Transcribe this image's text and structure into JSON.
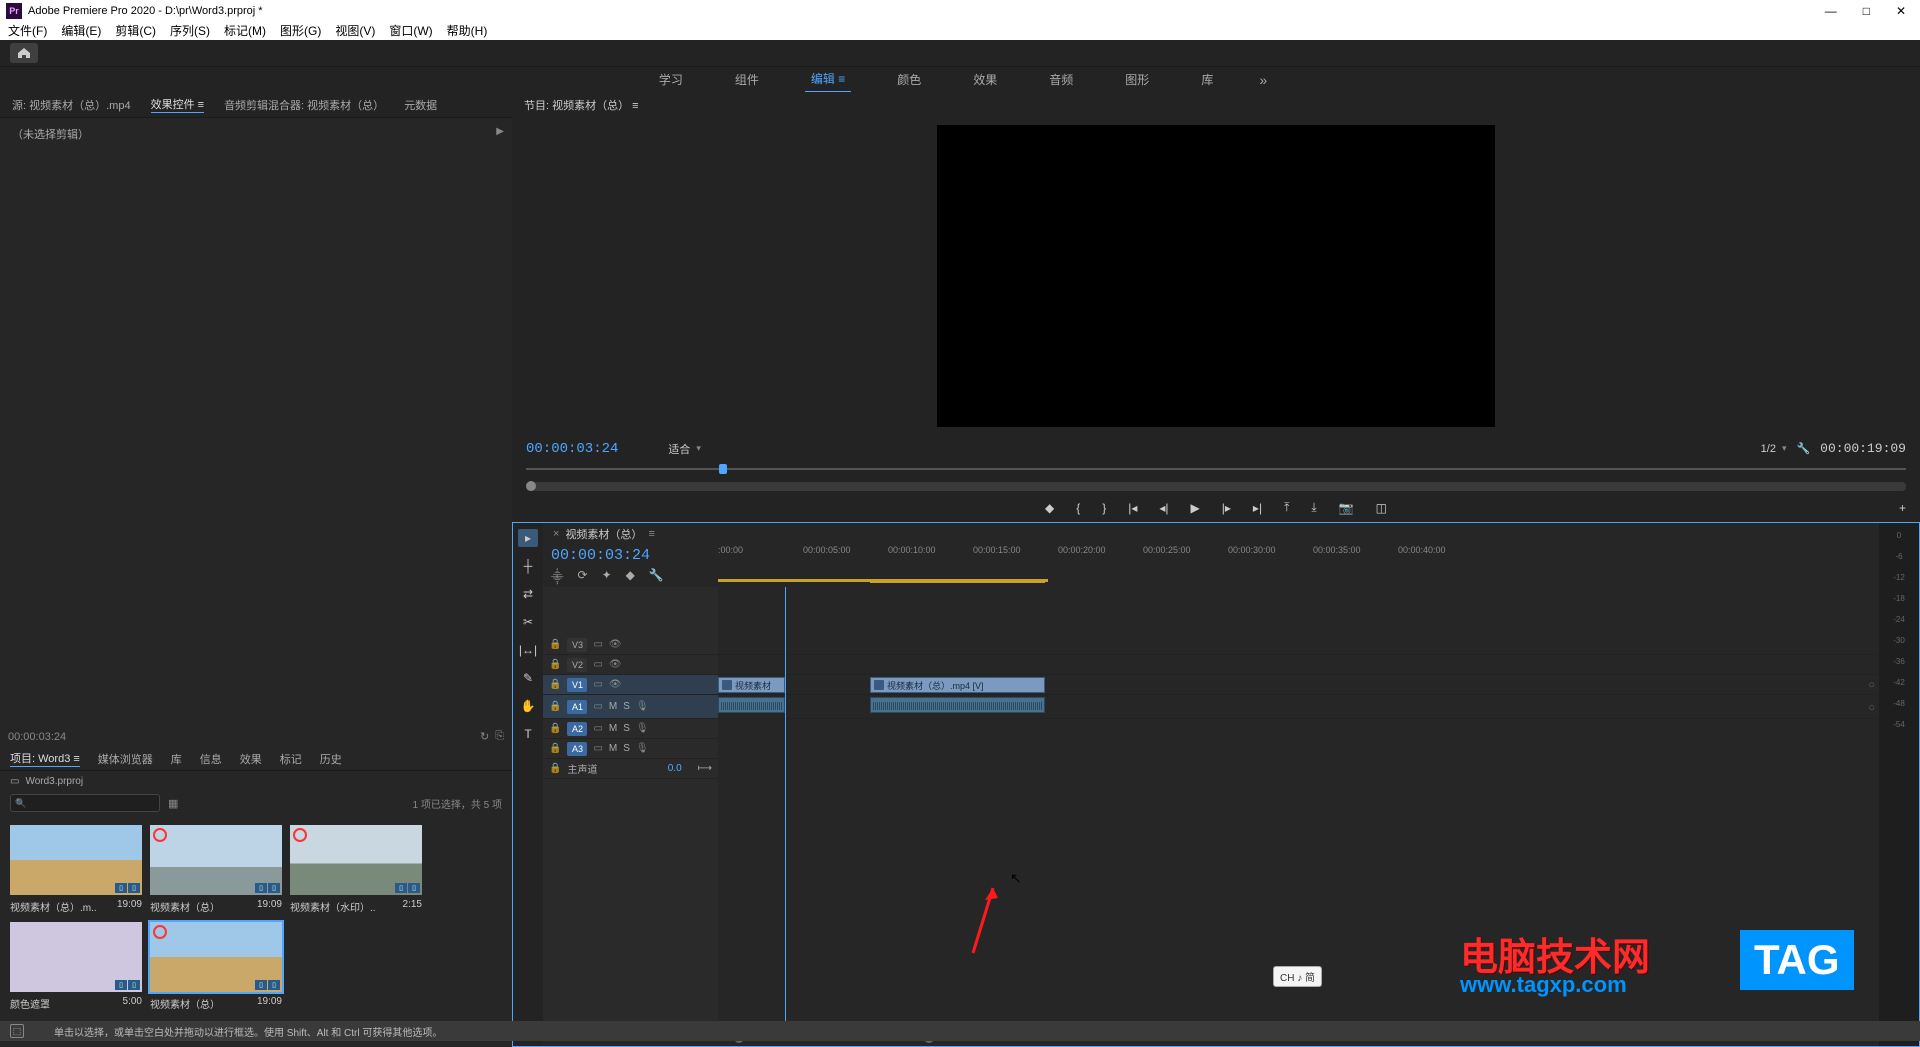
{
  "title": "Adobe Premiere Pro 2020 - D:\\pr\\Word3.prproj *",
  "menu": [
    "文件(F)",
    "编辑(E)",
    "剪辑(C)",
    "序列(S)",
    "标记(M)",
    "图形(G)",
    "视图(V)",
    "窗口(W)",
    "帮助(H)"
  ],
  "workspaces": {
    "items": [
      "学习",
      "组件",
      "编辑",
      "颜色",
      "效果",
      "音频",
      "图形",
      "库"
    ],
    "active": 2,
    "more": "»"
  },
  "srcTabs": {
    "items": [
      "源: 视频素材（总）.mp4",
      "效果控件",
      "音频剪辑混合器: 视频素材（总）",
      "元数据"
    ],
    "active": 1
  },
  "effCtrl": {
    "noClip": "（未选择剪辑）",
    "tc": "00:00:03:24"
  },
  "program": {
    "tab": "节目: 视频素材（总）",
    "tc": "00:00:03:24",
    "fit": "适合",
    "scale": "1/2",
    "dur": "00:00:19:09"
  },
  "project": {
    "tabs": [
      "项目: Word3",
      "媒体浏览器",
      "库",
      "信息",
      "效果",
      "标记",
      "历史"
    ],
    "active": 0,
    "bin": "Word3.prproj",
    "selInfo": "1 项已选择，共 5 项",
    "items": [
      {
        "name": "视频素材（总）.m..",
        "dur": "19:09",
        "scene": "scene1"
      },
      {
        "name": "视频素材（总）",
        "dur": "19:09",
        "scene": "scene2",
        "badge": true
      },
      {
        "name": "视频素材（水印）..",
        "dur": "2:15",
        "scene": "scene3",
        "badge": true
      },
      {
        "name": "颜色遮罩",
        "dur": "5:00",
        "scene": "lav"
      },
      {
        "name": "视频素材（总）",
        "dur": "19:09",
        "scene": "scene1",
        "badge": true,
        "selected": true
      }
    ]
  },
  "timeline": {
    "tab": "视频素材（总）",
    "tc": "00:00:03:24",
    "ticks": [
      ":00:00",
      "00:00:05:00",
      "00:00:10:00",
      "00:00:15:00",
      "00:00:20:00",
      "00:00:25:00",
      "00:00:30:00",
      "00:00:35:00",
      "00:00:40:00"
    ],
    "tracks": {
      "video": [
        {
          "id": "V3"
        },
        {
          "id": "V2"
        },
        {
          "id": "V1",
          "hl": true
        }
      ],
      "audio": [
        {
          "id": "A1",
          "hl": true
        },
        {
          "id": "A2",
          "hl": true
        },
        {
          "id": "A3",
          "hl": true
        }
      ],
      "master": "主声道",
      "masterVal": "0.0"
    },
    "clips": {
      "v1a": {
        "label": "视频素材"
      },
      "v1b": {
        "label": "视频素材（总）.mp4 [V]"
      }
    },
    "tools": [
      "▸",
      "┼",
      "⇄",
      "✂",
      "⬌",
      "[+]",
      "✎",
      "✋",
      "T"
    ]
  },
  "meters": [
    "0",
    "-6",
    "-12",
    "-18",
    "-24",
    "-30",
    "-36",
    "-42",
    "-48",
    "-54"
  ],
  "status": {
    "hint": "单击以选择，或单击空白处并拖动以进行框选。使用 Shift、Alt 和 Ctrl 可获得其他选项。"
  },
  "ime": "CH ♪ 简",
  "watermark": {
    "line1": "电脑技术网",
    "line2": "www.tagxp.com",
    "tag": "TAG"
  }
}
